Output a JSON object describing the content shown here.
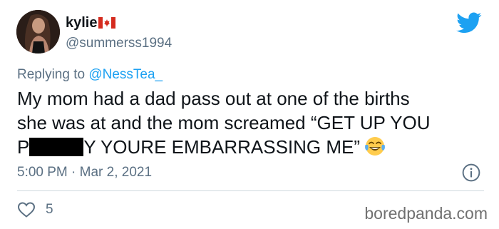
{
  "user": {
    "display_name": "kylie",
    "handle": "@summerss1994"
  },
  "icons": {
    "flag": "canada-flag-icon",
    "brand": "twitter-bird-icon",
    "emoji": "tears-of-joy-emoji",
    "info": "info-icon",
    "like": "heart-icon"
  },
  "reply": {
    "prefix": "Replying to",
    "mention": "@NessTea_"
  },
  "tweet": {
    "line1": "My mom had a dad pass out at one of the births",
    "line2": "she was at and the mom screamed “GET UP YOU",
    "line3_start": "P",
    "line3_end": "Y YOURE EMBARRASSING ME”"
  },
  "meta": {
    "timestamp": "5:00 PM · Mar 2, 2021",
    "like_count": "5"
  },
  "watermark": "boredpanda.com",
  "colors": {
    "brand_blue": "#1da1f2",
    "secondary_text": "#5b7083",
    "primary_text": "#0f1419",
    "flag_red": "#d52b1e"
  }
}
